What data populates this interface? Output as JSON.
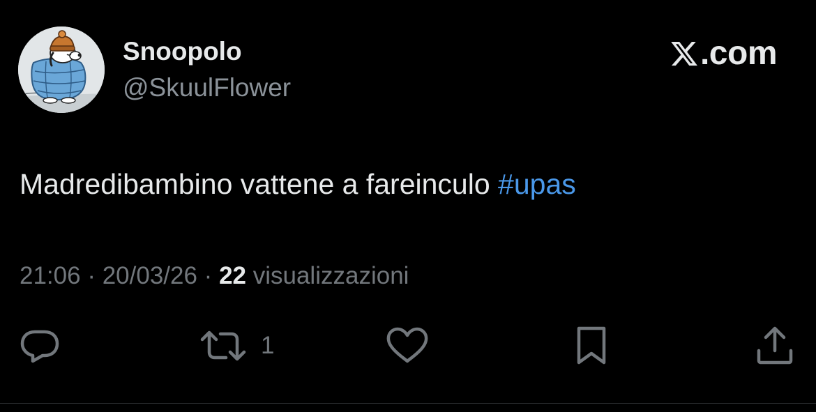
{
  "author": {
    "display_name": "Snoopolo",
    "handle": "@SkuulFlower",
    "avatar_icon": "snoopy-puffer-jacket-avatar"
  },
  "brand": {
    "icon": "x-logo-icon",
    "domain": ".com"
  },
  "tweet": {
    "text": "Madredibambino vattene a fareinculo ",
    "hashtag": "#upas"
  },
  "meta": {
    "time": "21:06",
    "separator": " · ",
    "date": "20/03/26",
    "views_count": "22",
    "views_label": " visualizzazioni"
  },
  "actions": {
    "reply_icon": "reply-icon",
    "repost_icon": "repost-icon",
    "repost_count": "1",
    "like_icon": "heart-icon",
    "bookmark_icon": "bookmark-icon",
    "share_icon": "share-icon"
  },
  "colors": {
    "background": "#000000",
    "text_primary": "#e7e9ea",
    "text_secondary": "#72777c",
    "hashtag": "#4a98e9",
    "divider": "#2f3336"
  }
}
